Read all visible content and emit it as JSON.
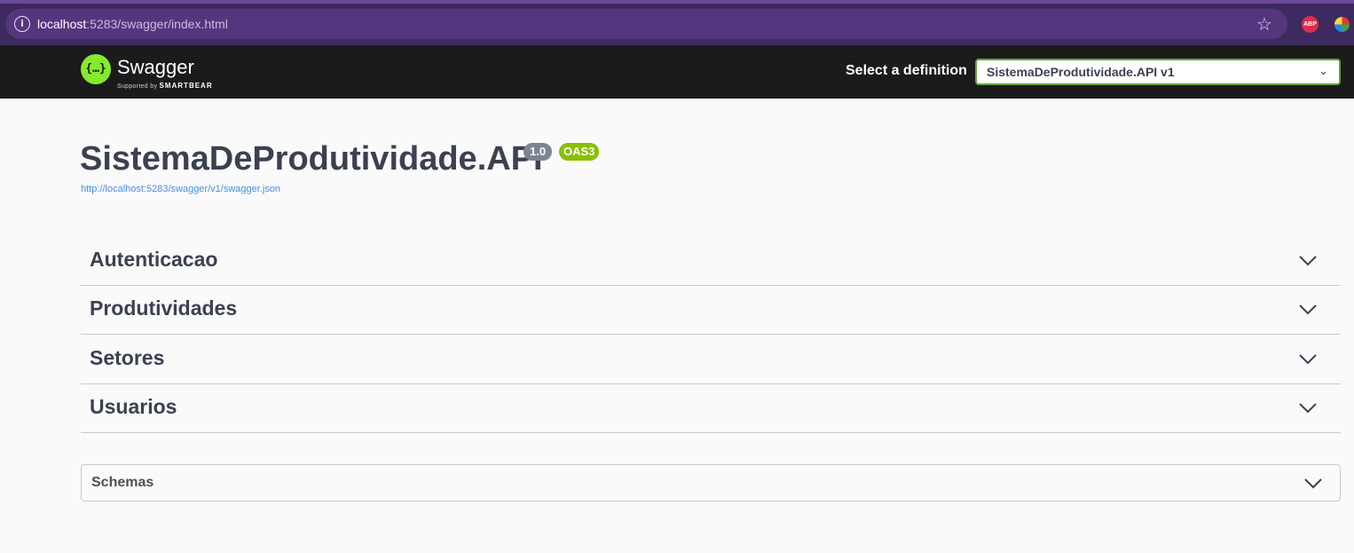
{
  "browser": {
    "url_host": "localhost",
    "url_rest": ":5283/swagger/index.html",
    "info_glyph": "i",
    "star_glyph": "☆",
    "abp_label": "ABP"
  },
  "topbar": {
    "logo_glyph": "{…}",
    "logo_name": "Swagger",
    "logo_tagline_prefix": "Supported by",
    "logo_tagline_brand": "SMARTBEAR",
    "select_label": "Select a definition",
    "selected_definition": "SistemaDeProdutividade.API v1",
    "select_arrow": "⌄"
  },
  "info": {
    "title": "SistemaDeProdutividade.API",
    "version_badge": "1.0",
    "oas_badge": "OAS3",
    "spec_url": "http://localhost:5283/swagger/v1/swagger.json"
  },
  "tags": [
    "Autenticacao",
    "Produtividades",
    "Setores",
    "Usuarios"
  ],
  "schemas": {
    "label": "Schemas"
  },
  "colors": {
    "browser_bg": "#3d2a5e",
    "topbar_bg": "#1b1b1b",
    "swagger_green": "#85ea2d",
    "oas_green": "#89bf04",
    "link_blue": "#4990e2"
  }
}
